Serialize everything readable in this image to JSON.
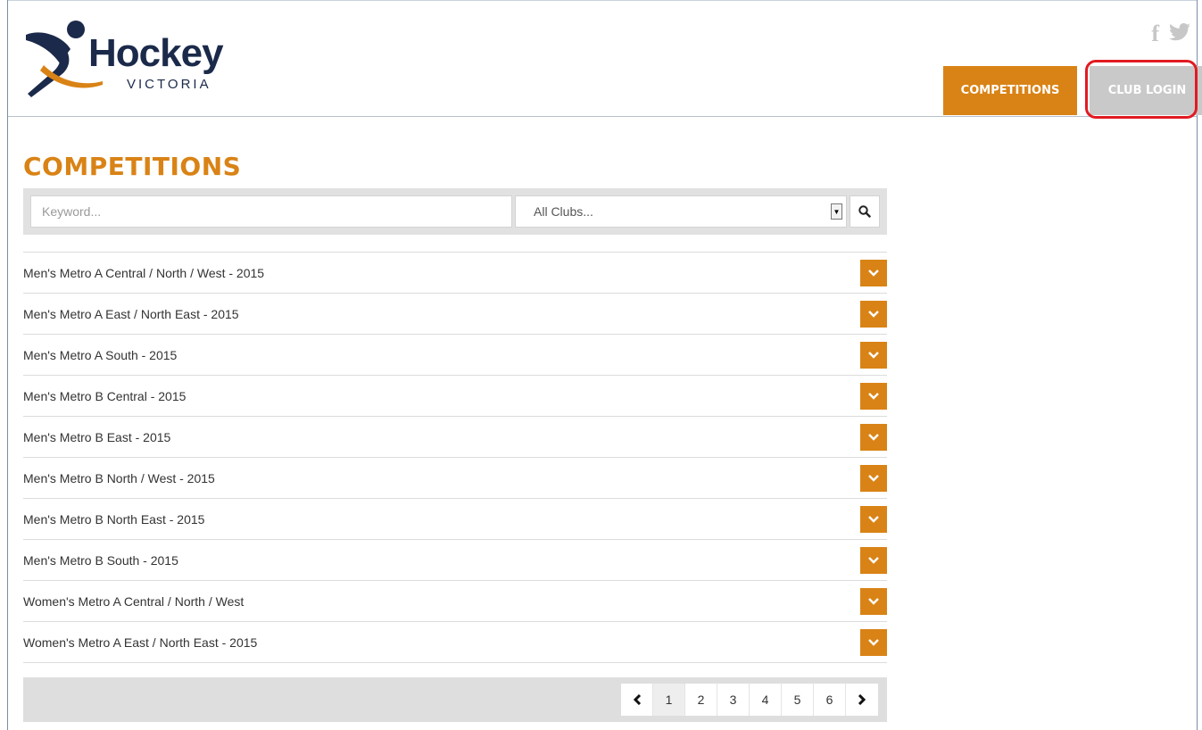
{
  "brand": {
    "name": "Hockey",
    "subtitle": "VICTORIA",
    "accent": "#d98316",
    "navy": "#1b2a4a"
  },
  "social": {
    "facebook": "f",
    "twitter_icon": "twitter-icon"
  },
  "nav": {
    "competitions": "COMPETITIONS",
    "club_login": "CLUB LOGIN"
  },
  "page": {
    "title": "COMPETITIONS"
  },
  "search": {
    "keyword_placeholder": "Keyword...",
    "club_select": "All Clubs...",
    "search_icon": "search-icon"
  },
  "competitions": [
    "Men's Metro A Central / North / West - 2015",
    "Men's Metro A East / North East - 2015",
    "Men's Metro A South - 2015",
    "Men's Metro B Central - 2015",
    "Men's Metro B East - 2015",
    "Men's Metro B North / West - 2015",
    "Men's Metro B North East - 2015",
    "Men's Metro B South - 2015",
    "Women's Metro A Central / North / West",
    "Women's Metro A East / North East - 2015"
  ],
  "pagination": {
    "prev": "‹",
    "next": "›",
    "pages": [
      "1",
      "2",
      "3",
      "4",
      "5",
      "6"
    ],
    "current": "1"
  }
}
